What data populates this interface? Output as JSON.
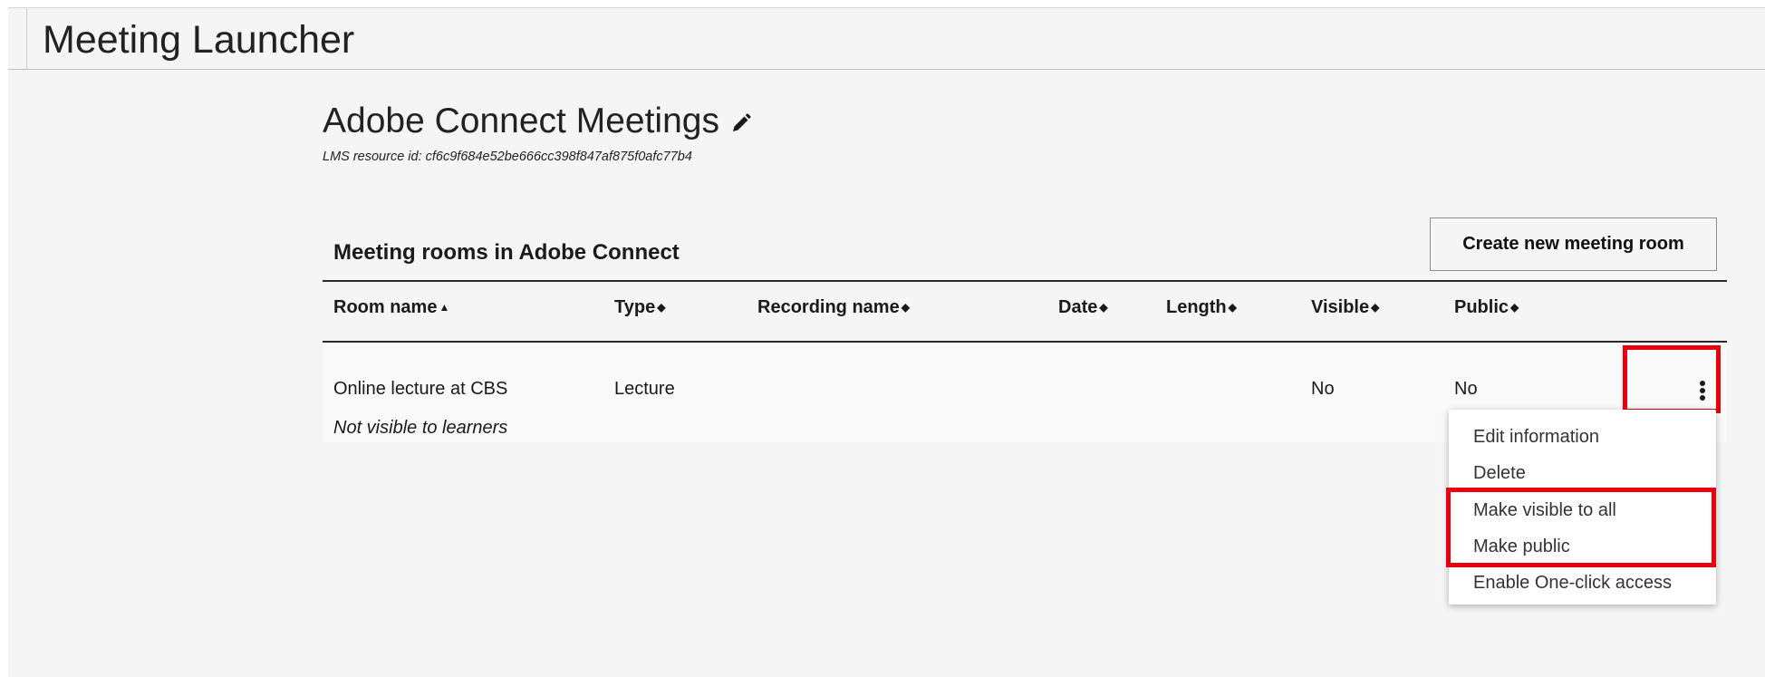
{
  "app": {
    "title": "Meeting Launcher"
  },
  "page": {
    "title": "Adobe Connect Meetings",
    "edit_icon": "pencil-icon",
    "resource_id": "LMS resource id: cf6c9f684e52be666cc398f847af875f0afc77b4"
  },
  "section": {
    "title": "Meeting rooms in Adobe Connect",
    "create_button": "Create new meeting room"
  },
  "table": {
    "columns": [
      {
        "label": "Room name",
        "sort": "▲"
      },
      {
        "label": "Type",
        "sort": "◆"
      },
      {
        "label": "Recording name",
        "sort": "◆"
      },
      {
        "label": "Date",
        "sort": "◆"
      },
      {
        "label": "Length",
        "sort": "◆"
      },
      {
        "label": "Visible",
        "sort": "◆"
      },
      {
        "label": "Public",
        "sort": "◆"
      }
    ],
    "rows": [
      {
        "room_name": "Online lecture at CBS",
        "note": "Not visible to learners",
        "type": "Lecture",
        "recording_name": "",
        "date": "",
        "length": "",
        "visible": "No",
        "public": "No",
        "actions_icon": "kebab-menu-icon"
      }
    ]
  },
  "context_menu": {
    "items": [
      "Edit information",
      "Delete",
      "Make visible to all",
      "Make public",
      "Enable One-click access"
    ]
  },
  "colors": {
    "background": "#f5f5f5",
    "highlight": "#e8000d",
    "text": "#1a1a1a"
  }
}
